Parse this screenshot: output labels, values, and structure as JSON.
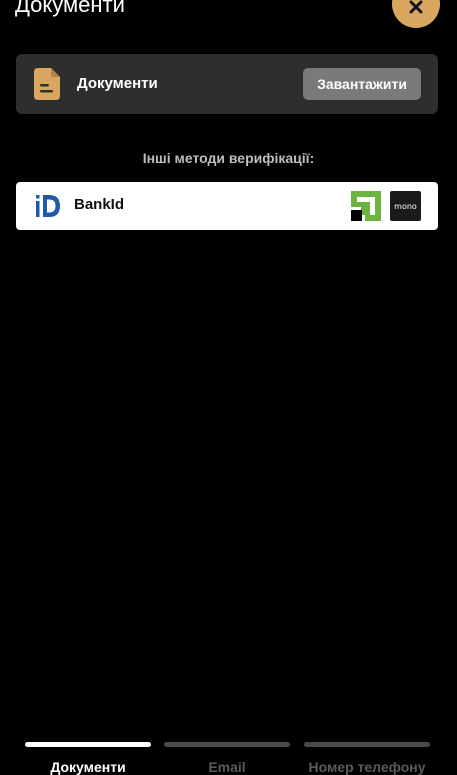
{
  "header": {
    "title": "Документи",
    "close_icon": "close-icon"
  },
  "documents_card": {
    "label": "Документи",
    "icon": "document-icon",
    "upload_label": "Завантажити"
  },
  "other_methods": {
    "heading": "Інші методи верифікації:",
    "bankid": {
      "label": "BankId",
      "icon": "bankid-icon",
      "bank_icons": [
        "privatbank-icon",
        "monobank-icon"
      ],
      "mono_text": "mono"
    }
  },
  "tabs": [
    {
      "label": "Документи",
      "active": true
    },
    {
      "label": "Email",
      "active": false
    },
    {
      "label": "Номер телефону",
      "active": false
    }
  ],
  "colors": {
    "accent": "#d8a65f",
    "background": "#000000",
    "card": "#2e2e2e",
    "button": "#7a7a7a",
    "privat_green": "#6cb33f",
    "bankid_blue": "#1f5aa8"
  }
}
